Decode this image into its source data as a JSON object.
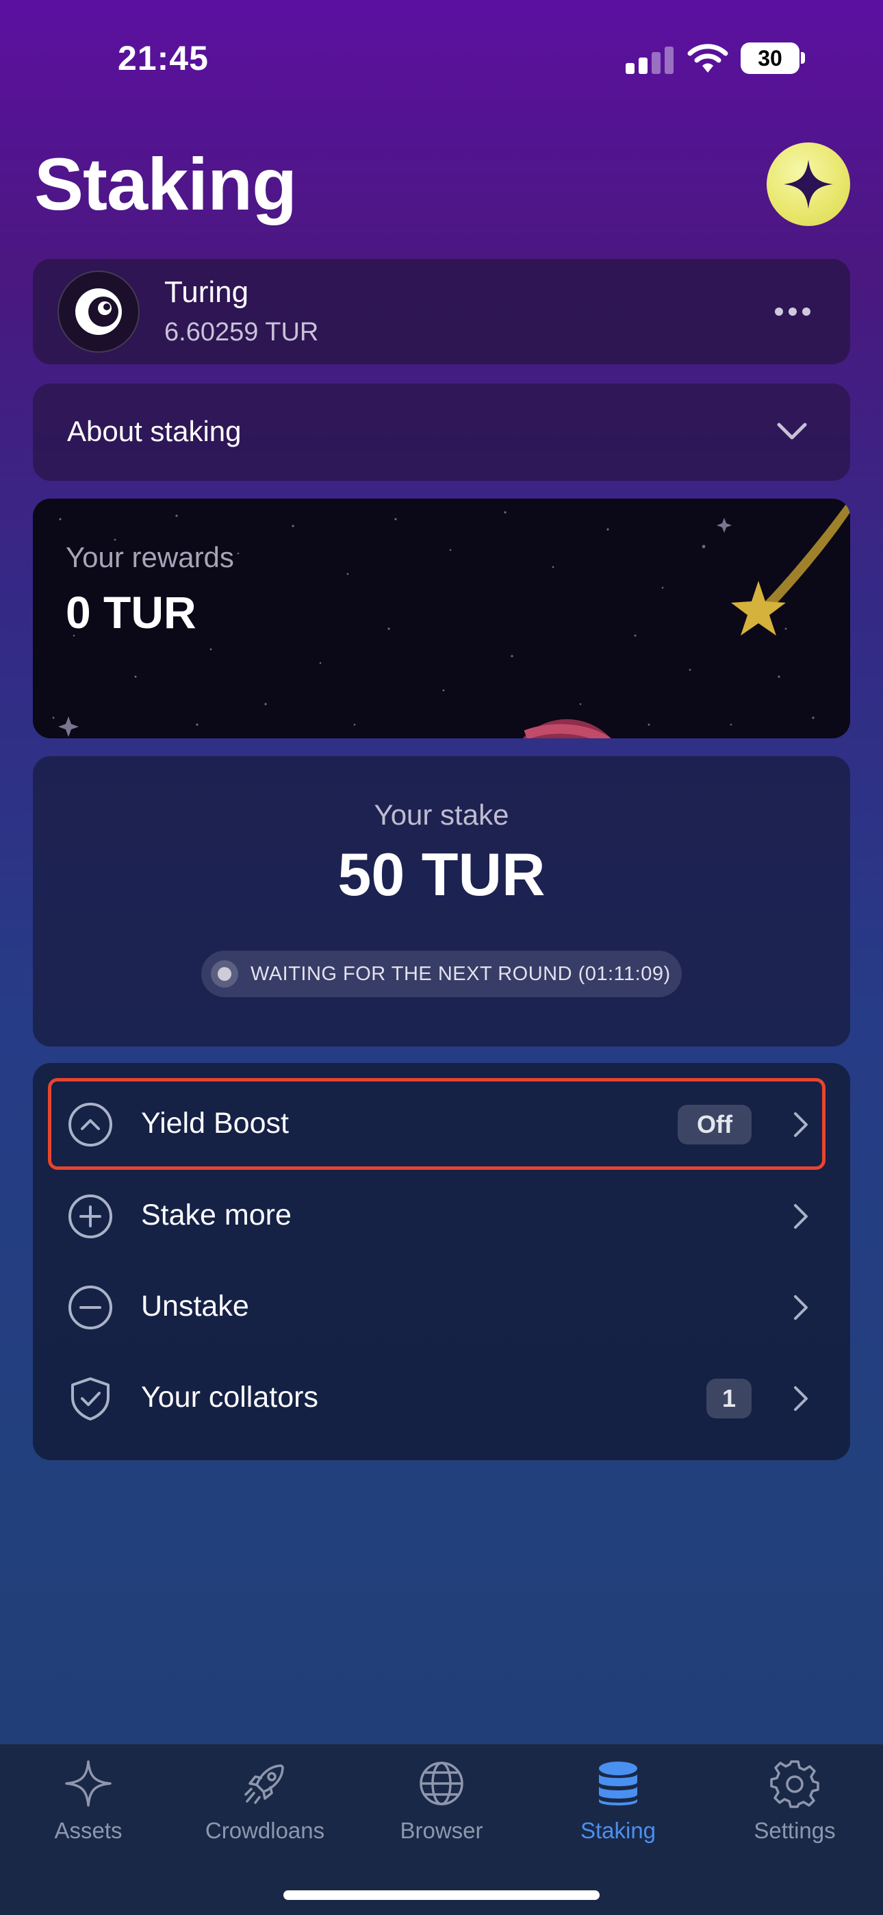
{
  "status_bar": {
    "time": "21:45",
    "battery": "30"
  },
  "page": {
    "title": "Staking"
  },
  "account": {
    "name": "Turing",
    "balance": "6.60259 TUR"
  },
  "about": {
    "label": "About staking"
  },
  "rewards": {
    "label": "Your rewards",
    "value": "0 TUR"
  },
  "stake": {
    "label": "Your stake",
    "value": "50 TUR",
    "status": "WAITING FOR THE NEXT ROUND (01:11:09)"
  },
  "menu": {
    "items": [
      {
        "label": "Yield Boost",
        "badge": "Off",
        "icon": "chevron-up-circle-icon"
      },
      {
        "label": "Stake more",
        "icon": "plus-circle-icon"
      },
      {
        "label": "Unstake",
        "icon": "minus-circle-icon"
      },
      {
        "label": "Your collators",
        "badge": "1",
        "icon": "shield-check-icon"
      }
    ]
  },
  "tabs": [
    {
      "label": "Assets",
      "icon": "sparkle-icon"
    },
    {
      "label": "Crowdloans",
      "icon": "rocket-icon"
    },
    {
      "label": "Browser",
      "icon": "globe-icon"
    },
    {
      "label": "Staking",
      "icon": "database-icon",
      "active": true
    },
    {
      "label": "Settings",
      "icon": "gear-icon"
    }
  ],
  "colors": {
    "accent": "#4a90f0",
    "highlight": "#e8442e",
    "spark": "#e8e66a"
  }
}
